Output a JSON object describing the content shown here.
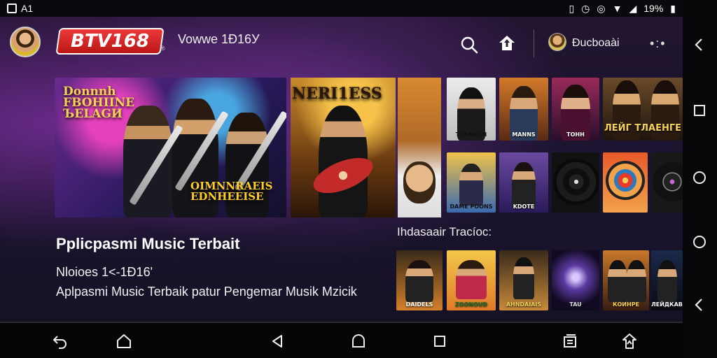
{
  "status_bar": {
    "left_text": "A1",
    "battery_text": "19%",
    "icons": [
      "sim-icon",
      "vibrate-icon",
      "alarm-icon",
      "whatsapp-icon",
      "wifi-icon",
      "signal-icon",
      "battery-icon"
    ]
  },
  "header": {
    "logo_text": "BTV168",
    "logo_mark": "®",
    "version_text": "Vowwe 1Ð16У",
    "username": "Ðucboaài",
    "more_label": "•:•",
    "icons": [
      "search-icon",
      "home-up-icon",
      "more-icon"
    ]
  },
  "featured": {
    "banner1_title": "Donnnh FBOHIINE ЪELAGИ",
    "banner1_subtitle": "OIMNNRAEIS EDNHEEISE",
    "banner2_title": "NERI1ESS"
  },
  "albums_top": [
    {
      "label": "TRANNUN"
    },
    {
      "label": "MANNS"
    },
    {
      "label": "ТОНН"
    },
    {
      "label": "ЛЕЙГ ТЛАЕНГЕ"
    }
  ],
  "albums_mid": [
    {
      "label": "DAME POONS"
    },
    {
      "label": "KDOTE"
    }
  ],
  "main_text": {
    "title": "Pplicpasmi Music Terbait",
    "release_info": "Nloioes 1<-1Ð16'",
    "description": "Aplpasmi Music Terbaik patur Pengemar Musik Mzicik"
  },
  "row": {
    "title": "Ihdasaair Tracíoc:",
    "albums": [
      {
        "label": "DAIDELS"
      },
      {
        "label": "ZOONOUD"
      },
      {
        "label": "AHNDAIAIS"
      },
      {
        "label": "TAU"
      },
      {
        "label": "КОИНРЕ"
      },
      {
        "label": "ЛЕЙДКАВ"
      }
    ]
  },
  "colors": {
    "logo_red": "#d62424",
    "background": "#1c1430",
    "accent_gold": "#f4d05a"
  }
}
